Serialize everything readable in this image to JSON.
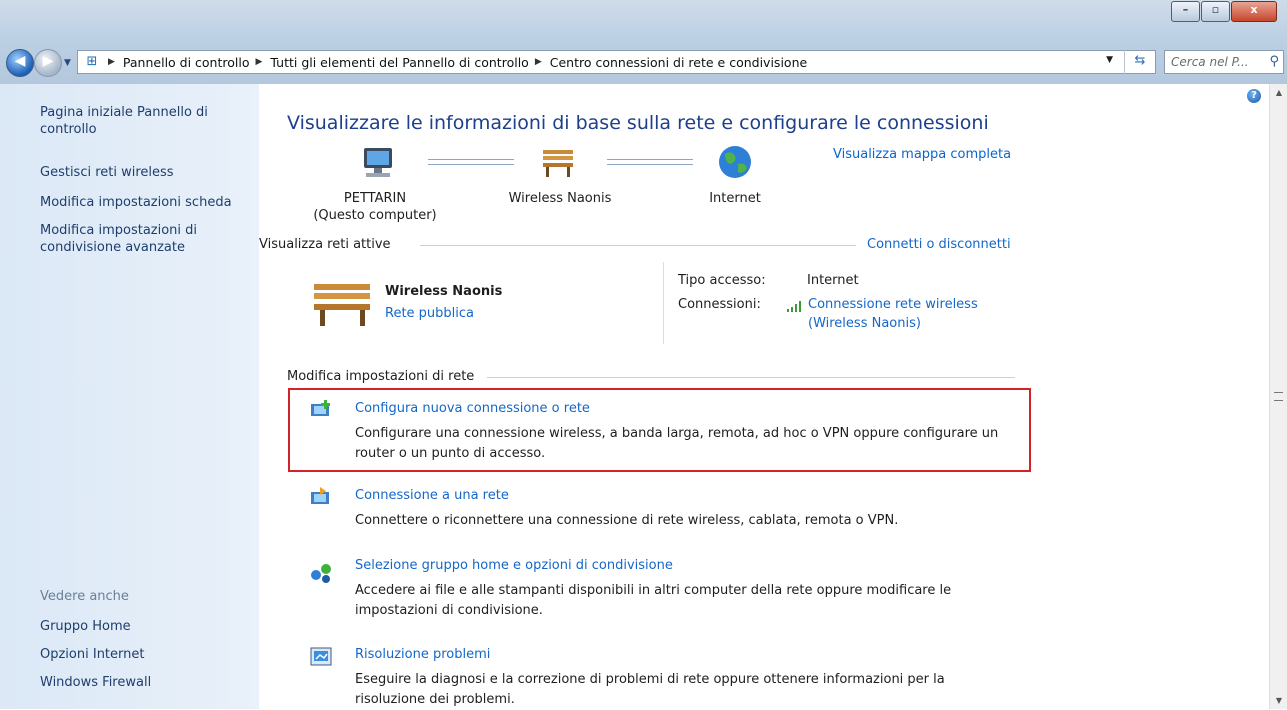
{
  "window": {
    "minimize_glyph": "–",
    "maximize_glyph": "▫",
    "close_glyph": "x"
  },
  "address": {
    "breadcrumbs": [
      "Pannello di controllo",
      "Tutti gli elementi del Pannello di controllo",
      "Centro connessioni di rete e condivisione"
    ],
    "search_placeholder": "Cerca nel P..."
  },
  "sidebar": {
    "items": [
      "Pagina iniziale Pannello di controllo",
      "Gestisci reti wireless",
      "Modifica impostazioni scheda",
      "Modifica impostazioni di condivisione avanzate"
    ],
    "see_also_label": "Vedere anche",
    "see_also": [
      "Gruppo Home",
      "Opzioni Internet",
      "Windows Firewall"
    ]
  },
  "main": {
    "title": "Visualizzare le informazioni di base sulla rete e configurare le connessioni",
    "map_link": "Visualizza mappa completa",
    "nodes": [
      {
        "label": "PETTARIN",
        "sub": "(Questo computer)"
      },
      {
        "label": "Wireless Naonis",
        "sub": ""
      },
      {
        "label": "Internet",
        "sub": ""
      }
    ],
    "active_networks_label": "Visualizza reti attive",
    "connect_link": "Connetti o disconnetti",
    "network": {
      "name": "Wireless Naonis",
      "type_link": "Rete pubblica",
      "access_label": "Tipo accesso:",
      "access_value": "Internet",
      "connections_label": "Connessioni:",
      "connection_link_1": "Connessione rete wireless",
      "connection_link_2": "(Wireless Naonis)"
    },
    "change_settings_label": "Modifica impostazioni di rete",
    "tasks": [
      {
        "title": "Configura nuova connessione o rete",
        "desc": "Configurare una connessione wireless, a banda larga, remota, ad hoc o VPN oppure configurare un router o un punto di accesso."
      },
      {
        "title": "Connessione a una rete",
        "desc": "Connettere o riconnettere una connessione di rete wireless, cablata, remota o VPN."
      },
      {
        "title": "Selezione gruppo home e opzioni di condivisione",
        "desc": "Accedere ai file e alle stampanti disponibili in altri computer della rete oppure modificare le impostazioni di condivisione."
      },
      {
        "title": "Risoluzione problemi",
        "desc": "Eseguire la diagnosi e la correzione di problemi di rete oppure ottenere informazioni per la risoluzione dei problemi."
      }
    ]
  },
  "colors": {
    "highlight_border": "#d2232a",
    "link": "#1467c8",
    "title": "#1e3f8b"
  }
}
